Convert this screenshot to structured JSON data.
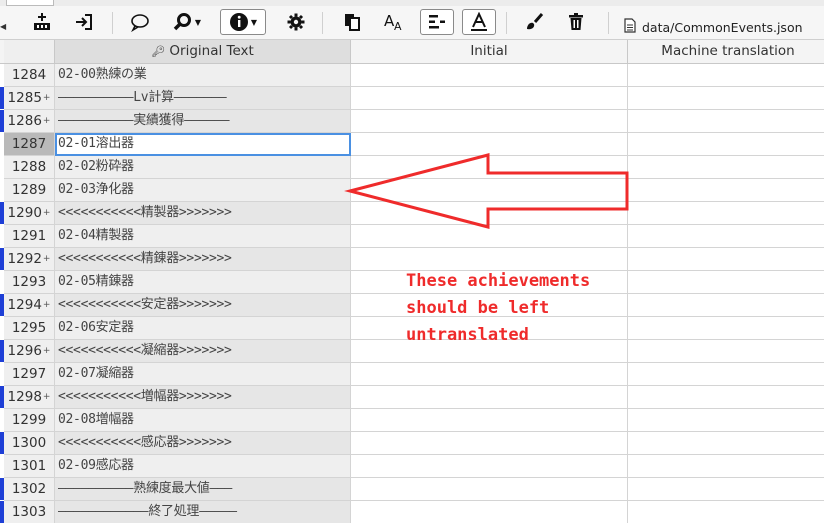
{
  "toolbar": {
    "file_label": "data/CommonEvents.json"
  },
  "icons": {
    "add": "add-row-icon",
    "import": "import-icon",
    "comment": "speech-bubble-icon",
    "search": "search-icon",
    "info": "info-icon",
    "settings": "gear-icon",
    "copy": "copy-icon",
    "font": "font-size-icon",
    "wrap": "wrap-text-icon",
    "text": "text-color-icon",
    "brush": "brush-icon",
    "trash": "trash-icon",
    "file": "file-icon"
  },
  "table": {
    "headers": {
      "original": "Original Text",
      "initial": "Initial",
      "machine": "Machine translation"
    },
    "rows": [
      {
        "num": "1284",
        "text": "02-00熟練の業",
        "marker": false,
        "plus": false,
        "selected": false
      },
      {
        "num": "1285",
        "text": "――――――――――Lv計算―――――――",
        "marker": true,
        "plus": true,
        "selected": false
      },
      {
        "num": "1286",
        "text": "――――――――――実績獲得――――――",
        "marker": true,
        "plus": true,
        "selected": false
      },
      {
        "num": "1287",
        "text": "02-01溶出器",
        "marker": false,
        "plus": false,
        "selected": true
      },
      {
        "num": "1288",
        "text": "02-02粉砕器",
        "marker": false,
        "plus": false,
        "selected": false
      },
      {
        "num": "1289",
        "text": "02-03浄化器",
        "marker": false,
        "plus": false,
        "selected": false
      },
      {
        "num": "1290",
        "text": "<<<<<<<<<<<精製器>>>>>>>",
        "marker": true,
        "plus": true,
        "selected": false
      },
      {
        "num": "1291",
        "text": "02-04精製器",
        "marker": false,
        "plus": false,
        "selected": false
      },
      {
        "num": "1292",
        "text": "<<<<<<<<<<<精錬器>>>>>>>",
        "marker": true,
        "plus": true,
        "selected": false
      },
      {
        "num": "1293",
        "text": "02-05精錬器",
        "marker": false,
        "plus": false,
        "selected": false
      },
      {
        "num": "1294",
        "text": "<<<<<<<<<<<安定器>>>>>>>",
        "marker": true,
        "plus": true,
        "selected": false
      },
      {
        "num": "1295",
        "text": "02-06安定器",
        "marker": false,
        "plus": false,
        "selected": false
      },
      {
        "num": "1296",
        "text": "<<<<<<<<<<<凝縮器>>>>>>>",
        "marker": true,
        "plus": true,
        "selected": false
      },
      {
        "num": "1297",
        "text": "02-07凝縮器",
        "marker": false,
        "plus": false,
        "selected": false
      },
      {
        "num": "1298",
        "text": "<<<<<<<<<<<増幅器>>>>>>>",
        "marker": true,
        "plus": true,
        "selected": false
      },
      {
        "num": "1299",
        "text": "02-08増幅器",
        "marker": false,
        "plus": false,
        "selected": false
      },
      {
        "num": "1300",
        "text": "<<<<<<<<<<<感応器>>>>>>>",
        "marker": true,
        "plus": false,
        "selected": false
      },
      {
        "num": "1301",
        "text": "02-09感応器",
        "marker": false,
        "plus": false,
        "selected": false
      },
      {
        "num": "1302",
        "text": "――――――――――熟練度最大値―――",
        "marker": true,
        "plus": false,
        "selected": false
      },
      {
        "num": "1303",
        "text": "――――――――――――終了処理―――――",
        "marker": true,
        "plus": false,
        "selected": false
      }
    ]
  },
  "annotation": {
    "text": "These achievements\nshould be left\nuntranslated",
    "color": "#ef2b2b"
  },
  "colors": {
    "marker": "#1e3fd6",
    "selection": "#4a90e2"
  }
}
